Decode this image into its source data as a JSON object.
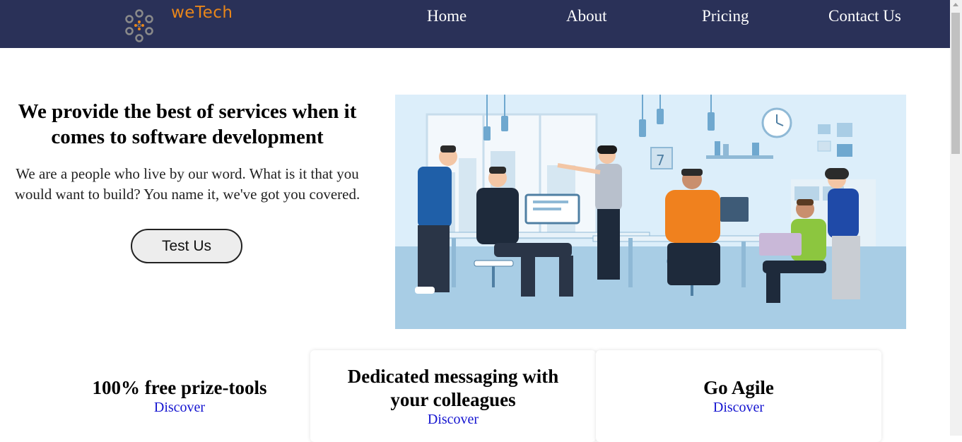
{
  "brand": {
    "name": "weTech",
    "accent": "#e8861a",
    "nav_bg": "#2a3158"
  },
  "nav": {
    "items": [
      "Home",
      "About",
      "Pricing",
      "Contact Us"
    ]
  },
  "hero": {
    "title": "We provide the best of services when it comes to software development",
    "text": "We are a people who live by our word. What is it that you would want to build? You name it, we've got you covered.",
    "cta": "Test Us",
    "illustration": "office-team-illustration"
  },
  "features": [
    {
      "title": "100% free prize-tools",
      "link": "Discover"
    },
    {
      "title": "Dedicated messaging with your colleagues",
      "link": "Discover"
    },
    {
      "title": "Go Agile",
      "link": "Discover"
    }
  ],
  "link_color": "#1414d0"
}
